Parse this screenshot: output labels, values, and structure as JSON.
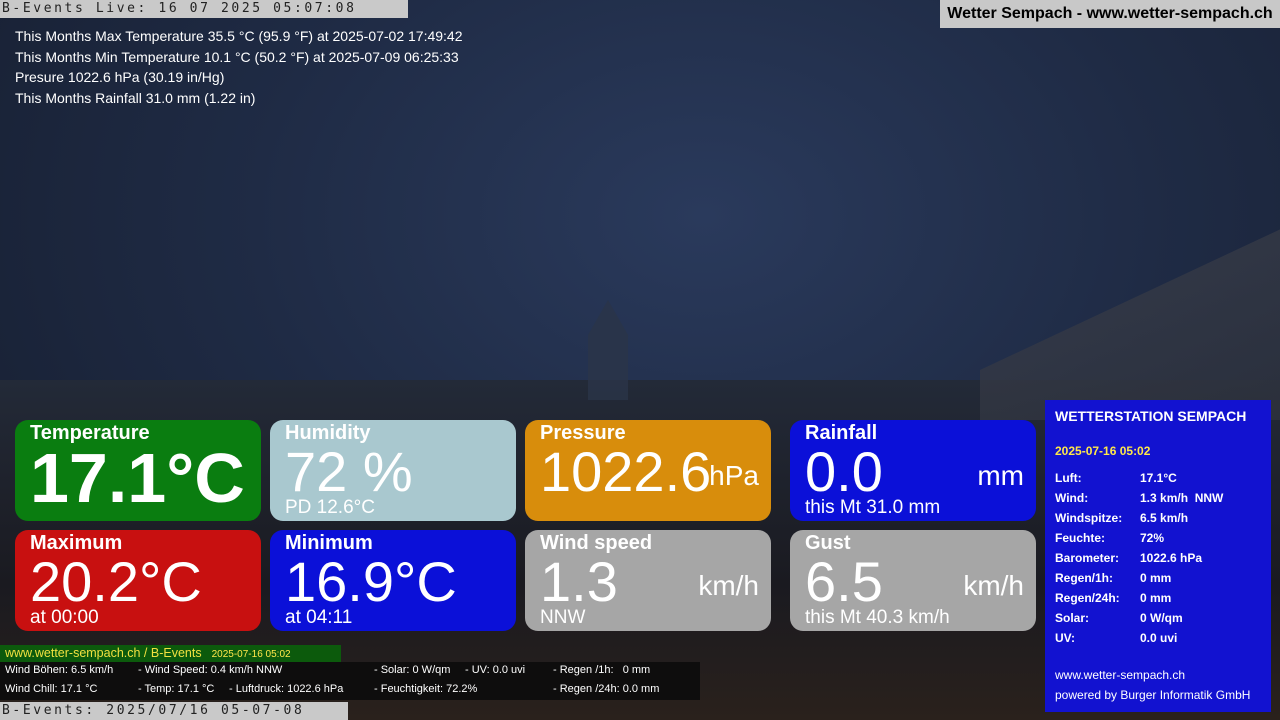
{
  "overlay": {
    "live_text": "B-Events Live: 16 07 2025 05:07:08",
    "bottom_text": "B-Events: 2025/07/16 05-07-08",
    "site_banner": "Wetter Sempach - www.wetter-sempach.ch"
  },
  "stats": {
    "max_temp": "This Months Max Temperature 35.5 °C (95.9 °F) at 2025-07-02 17:49:42",
    "min_temp": "This Months Min Temperature 10.1 °C (50.2 °F) at 2025-07-09 06:25:33",
    "pressure": "Presure 1022.6 hPa (30.19 in/Hg)",
    "rainfall": "This Months Rainfall 31.0 mm (1.22 in)"
  },
  "cards": {
    "temperature": {
      "title": "Temperature",
      "value": "17.1°C"
    },
    "humidity": {
      "title": "Humidity",
      "value": "72 %",
      "sub": "PD 12.6°C"
    },
    "pressure": {
      "title": "Pressure",
      "value": "1022.6",
      "unit": "hPa"
    },
    "rainfall": {
      "title": "Rainfall",
      "value": "0.0",
      "unit": "mm",
      "sub": "this Mt 31.0 mm"
    },
    "maximum": {
      "title": "Maximum",
      "value": "20.2°C",
      "sub": "at 00:00"
    },
    "minimum": {
      "title": "Minimum",
      "value": "16.9°C",
      "sub": "at 04:11"
    },
    "wind": {
      "title": "Wind speed",
      "value": "1.3",
      "unit": "km/h",
      "sub": "NNW"
    },
    "gust": {
      "title": "Gust",
      "value": "6.5",
      "unit": "km/h",
      "sub": "this Mt 40.3 km/h"
    }
  },
  "station": {
    "heading": "WETTERSTATION SEMPACH",
    "date": "2025-07-16 05:02",
    "rows": [
      {
        "k": "Luft:",
        "v": "17.1°C"
      },
      {
        "k": "Wind:",
        "v": "1.3 km/h  NNW"
      },
      {
        "k": "Windspitze:",
        "v": "6.5 km/h"
      },
      {
        "k": "Feuchte:",
        "v": "72%"
      },
      {
        "k": "Barometer:",
        "v": "1022.6 hPa"
      },
      {
        "k": "Regen/1h:",
        "v": "0 mm"
      },
      {
        "k": "Regen/24h:",
        "v": "0 mm"
      },
      {
        "k": "Solar:",
        "v": "0 W/qm"
      },
      {
        "k": "UV:",
        "v": "0.0 uvi"
      }
    ],
    "website": "www.wetter-sempach.ch",
    "powered": "powered by Burger Informatik GmbH"
  },
  "ticker": {
    "site": "www.wetter-sempach.ch / B-Events",
    "timestamp": "2025-07-16 05:02",
    "row1": {
      "a": "Wind Böhen: 6.5 km/h",
      "b": "- Wind Speed: 0.4 km/h NNW",
      "c": "- Solar: 0 W/qm",
      "d": "- UV: 0.0 uvi",
      "e": "- Regen /1h:   0 mm"
    },
    "row2": {
      "a": "Wind Chill: 17.1 °C",
      "b": "- Temp: 17.1 °C",
      "c": "- Luftdruck: 1022.6 hPa",
      "d": "- Feuchtigkeit: 72.2%",
      "e": "- Regen /24h: 0.0 mm"
    }
  }
}
